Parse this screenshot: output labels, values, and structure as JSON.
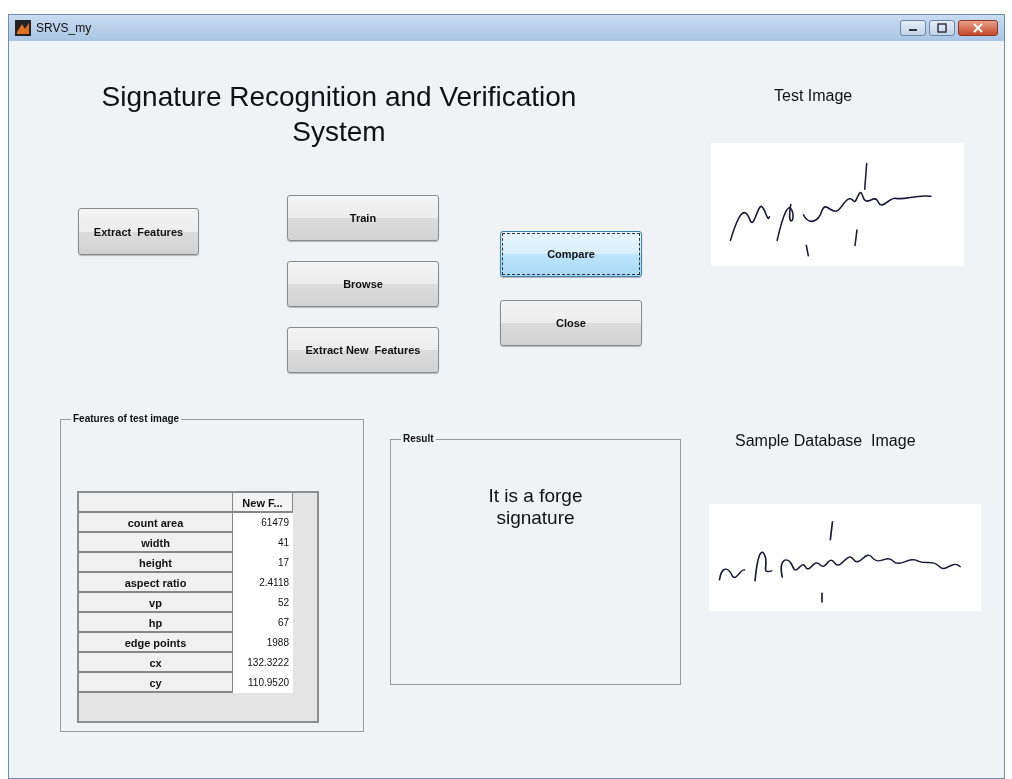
{
  "window": {
    "title": "SRVS_my"
  },
  "heading": "Signature Recognition and Verification System",
  "buttons": [
    {
      "label": "Extract  Features",
      "focused": false
    },
    {
      "label": "Train",
      "focused": false
    },
    {
      "label": "Browse",
      "focused": false
    },
    {
      "label": "Extract New  Features",
      "focused": false
    },
    {
      "label": "Compare",
      "focused": true
    },
    {
      "label": "Close",
      "focused": false
    }
  ],
  "features_panel": {
    "title": "Features of test image",
    "table": {
      "columns": [
        "New F..."
      ],
      "rows": [
        {
          "name": "count area",
          "value": "61479"
        },
        {
          "name": "width",
          "value": "41"
        },
        {
          "name": "height",
          "value": "17"
        },
        {
          "name": "aspect ratio",
          "value": "2.4118"
        },
        {
          "name": "vp",
          "value": "52"
        },
        {
          "name": "hp",
          "value": "67"
        },
        {
          "name": "edge points",
          "value": "1988"
        },
        {
          "name": "cx",
          "value": "132.3222"
        },
        {
          "name": "cy",
          "value": "110.9520"
        }
      ]
    }
  },
  "result_panel": {
    "title": "Result",
    "message": "It is a forge signature"
  },
  "test_image": {
    "label": "Test Image"
  },
  "sample_image": {
    "label": "Sample Database  Image"
  }
}
